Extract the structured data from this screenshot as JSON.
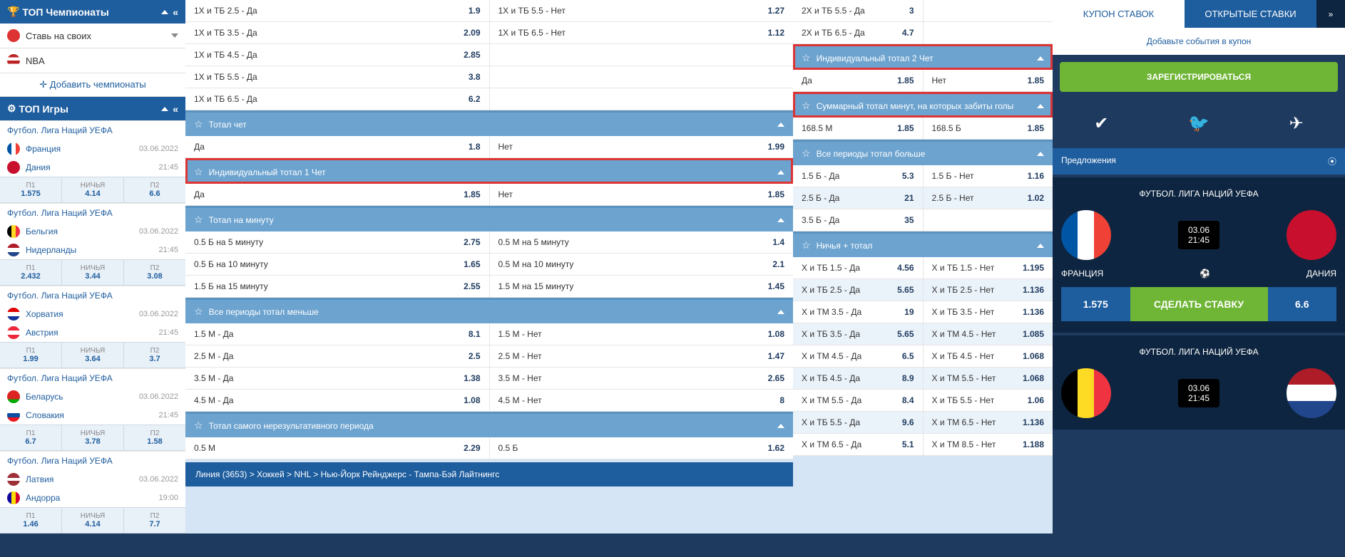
{
  "sidebar": {
    "top_champs": "ТОП Чемпионаты",
    "own_bet": "Ставь на своих",
    "nba": "NBA",
    "add_champs": "✛  Добавить чемпионаты",
    "top_games": "ТОП Игры",
    "leagues": [
      {
        "league": "Футбол. Лига Наций УЕФА",
        "teams": [
          {
            "name": "Франция",
            "meta": "03.06.2022",
            "flag": "flag-fr"
          },
          {
            "name": "Дания",
            "meta": "21:45",
            "flag": "flag-dk"
          }
        ],
        "odds": {
          "p1l": "П1",
          "p1": "1.575",
          "xl": "НИЧЬЯ",
          "x": "4.14",
          "p2l": "П2",
          "p2": "6.6"
        }
      },
      {
        "league": "Футбол. Лига Наций УЕФА",
        "teams": [
          {
            "name": "Бельгия",
            "meta": "03.06.2022",
            "flag": "flag-be"
          },
          {
            "name": "Нидерланды",
            "meta": "21:45",
            "flag": "flag-nl"
          }
        ],
        "odds": {
          "p1l": "П1",
          "p1": "2.432",
          "xl": "НИЧЬЯ",
          "x": "3.44",
          "p2l": "П2",
          "p2": "3.08"
        }
      },
      {
        "league": "Футбол. Лига Наций УЕФА",
        "teams": [
          {
            "name": "Хорватия",
            "meta": "03.06.2022",
            "flag": "flag-hr"
          },
          {
            "name": "Австрия",
            "meta": "21:45",
            "flag": "flag-at"
          }
        ],
        "odds": {
          "p1l": "П1",
          "p1": "1.99",
          "xl": "НИЧЬЯ",
          "x": "3.64",
          "p2l": "П2",
          "p2": "3.7"
        }
      },
      {
        "league": "Футбол. Лига Наций УЕФА",
        "teams": [
          {
            "name": "Беларусь",
            "meta": "03.06.2022",
            "flag": "flag-by"
          },
          {
            "name": "Словакия",
            "meta": "21:45",
            "flag": "flag-sk"
          }
        ],
        "odds": {
          "p1l": "П1",
          "p1": "6.7",
          "xl": "НИЧЬЯ",
          "x": "3.78",
          "p2l": "П2",
          "p2": "1.58"
        }
      },
      {
        "league": "Футбол. Лига Наций УЕФА",
        "teams": [
          {
            "name": "Латвия",
            "meta": "03.06.2022",
            "flag": "flag-lv"
          },
          {
            "name": "Андорра",
            "meta": "19:00",
            "flag": "flag-ad"
          }
        ],
        "odds": {
          "p1l": "П1",
          "p1": "1.46",
          "xl": "НИЧЬЯ",
          "x": "4.14",
          "p2l": "П2",
          "p2": "7.7"
        }
      }
    ]
  },
  "markets_left_pre": [
    {
      "l": "1X и ТБ 2.5 - Да",
      "lv": "1.9",
      "r": "1X и ТБ 5.5 - Нет",
      "rv": "1.27"
    },
    {
      "l": "1X и ТБ 3.5 - Да",
      "lv": "2.09",
      "r": "1X и ТБ 6.5 - Нет",
      "rv": "1.12"
    },
    {
      "l": "1X и ТБ 4.5 - Да",
      "lv": "2.85",
      "r": "",
      "rv": ""
    },
    {
      "l": "1X и ТБ 5.5 - Да",
      "lv": "3.8",
      "r": "",
      "rv": ""
    },
    {
      "l": "1X и ТБ 6.5 - Да",
      "lv": "6.2",
      "r": "",
      "rv": ""
    }
  ],
  "markets_left": [
    {
      "title": "Тотал чет",
      "rows": [
        {
          "l": "Да",
          "lv": "1.8",
          "r": "Нет",
          "rv": "1.99"
        }
      ],
      "hl": false
    },
    {
      "title": "Индивидуальный тотал 1 Чет",
      "rows": [
        {
          "l": "Да",
          "lv": "1.85",
          "r": "Нет",
          "rv": "1.85"
        }
      ],
      "hl": true
    },
    {
      "title": "Тотал на минуту",
      "rows": [
        {
          "l": "0.5 Б на 5 минуту",
          "lv": "2.75",
          "r": "0.5 М на 5 минуту",
          "rv": "1.4"
        },
        {
          "l": "0.5 Б на 10 минуту",
          "lv": "1.65",
          "r": "0.5 М на 10 минуту",
          "rv": "2.1"
        },
        {
          "l": "1.5 Б на 15 минуту",
          "lv": "2.55",
          "r": "1.5 М на 15 минуту",
          "rv": "1.45"
        }
      ],
      "hl": false
    },
    {
      "title": "Все периоды тотал меньше",
      "rows": [
        {
          "l": "1.5 М - Да",
          "lv": "8.1",
          "r": "1.5 М - Нет",
          "rv": "1.08"
        },
        {
          "l": "2.5 М - Да",
          "lv": "2.5",
          "r": "2.5 М - Нет",
          "rv": "1.47"
        },
        {
          "l": "3.5 М - Да",
          "lv": "1.38",
          "r": "3.5 М - Нет",
          "rv": "2.65"
        },
        {
          "l": "4.5 М - Да",
          "lv": "1.08",
          "r": "4.5 М - Нет",
          "rv": "8"
        }
      ],
      "hl": false
    },
    {
      "title": "Тотал самого нерезультативного периода",
      "rows": [
        {
          "l": "0.5 М",
          "lv": "2.29",
          "r": "0.5 Б",
          "rv": "1.62"
        }
      ],
      "hl": false
    }
  ],
  "markets_right_pre": [
    {
      "l": "2X и ТБ 5.5 - Да",
      "lv": "3",
      "r": "",
      "rv": ""
    },
    {
      "l": "2X и ТБ 6.5 - Да",
      "lv": "4.7",
      "r": "",
      "rv": ""
    }
  ],
  "markets_right": [
    {
      "title": "Индивидуальный тотал 2 Чет",
      "rows": [
        {
          "l": "Да",
          "lv": "1.85",
          "r": "Нет",
          "rv": "1.85"
        }
      ],
      "hl": true
    },
    {
      "title": "Суммарный тотал минут, на которых забиты голы",
      "rows": [
        {
          "l": "168.5 М",
          "lv": "1.85",
          "r": "168.5 Б",
          "rv": "1.85"
        }
      ],
      "hl": true
    },
    {
      "title": "Все периоды тотал больше",
      "rows": [
        {
          "l": "1.5 Б - Да",
          "lv": "5.3",
          "r": "1.5 Б - Нет",
          "rv": "1.16"
        },
        {
          "l": "2.5 Б - Да",
          "lv": "21",
          "r": "2.5 Б - Нет",
          "rv": "1.02"
        },
        {
          "l": "3.5 Б - Да",
          "lv": "35",
          "r": "",
          "rv": ""
        }
      ],
      "hl": false
    },
    {
      "title": "Ничья + тотал",
      "rows": [
        {
          "l": "X и ТБ 1.5 - Да",
          "lv": "4.56",
          "r": "X и ТБ 1.5 - Нет",
          "rv": "1.195"
        },
        {
          "l": "X и ТБ 2.5 - Да",
          "lv": "5.65",
          "r": "X и ТБ 2.5 - Нет",
          "rv": "1.136"
        },
        {
          "l": "X и ТМ 3.5 - Да",
          "lv": "19",
          "r": "X и ТБ 3.5 - Нет",
          "rv": "1.136"
        },
        {
          "l": "X и ТБ 3.5 - Да",
          "lv": "5.65",
          "r": "X и ТМ 4.5 - Нет",
          "rv": "1.085"
        },
        {
          "l": "X и ТМ 4.5 - Да",
          "lv": "6.5",
          "r": "X и ТБ 4.5 - Нет",
          "rv": "1.068"
        },
        {
          "l": "X и ТБ 4.5 - Да",
          "lv": "8.9",
          "r": "X и ТМ 5.5 - Нет",
          "rv": "1.068"
        },
        {
          "l": "X и ТМ 5.5 - Да",
          "lv": "8.4",
          "r": "X и ТБ 5.5 - Нет",
          "rv": "1.06"
        },
        {
          "l": "X и ТБ 5.5 - Да",
          "lv": "9.6",
          "r": "X и ТМ 6.5 - Нет",
          "rv": "1.136"
        },
        {
          "l": "X и ТМ 6.5 - Да",
          "lv": "5.1",
          "r": "X и ТМ 8.5 - Нет",
          "rv": "1.188"
        }
      ],
      "hl": false
    }
  ],
  "breadcrumb": "Линия (3653) > Хоккей > NHL > Нью-Йорк Рейнджерс - Тампа-Бэй Лайтнингс",
  "betslip": {
    "tab1": "КУПОН СТАВОК",
    "tab2": "ОТКРЫТЫЕ СТАВКИ",
    "add_msg": "Добавьте события в купон",
    "register": "ЗАРЕГИСТРИРОВАТЬСЯ",
    "offers": "Предложения",
    "offer1": {
      "title": "ФУТБОЛ. ЛИГА НАЦИЙ УЕФА",
      "date": "03.06",
      "time": "21:45",
      "team1": "ФРАНЦИЯ",
      "team2": "ДАНИЯ",
      "odd1": "1.575",
      "bet": "СДЕЛАТЬ СТАВКУ",
      "odd2": "6.6"
    },
    "offer2": {
      "title": "ФУТБОЛ. ЛИГА НАЦИЙ УЕФА",
      "date": "03.06",
      "time": "21:45"
    }
  }
}
